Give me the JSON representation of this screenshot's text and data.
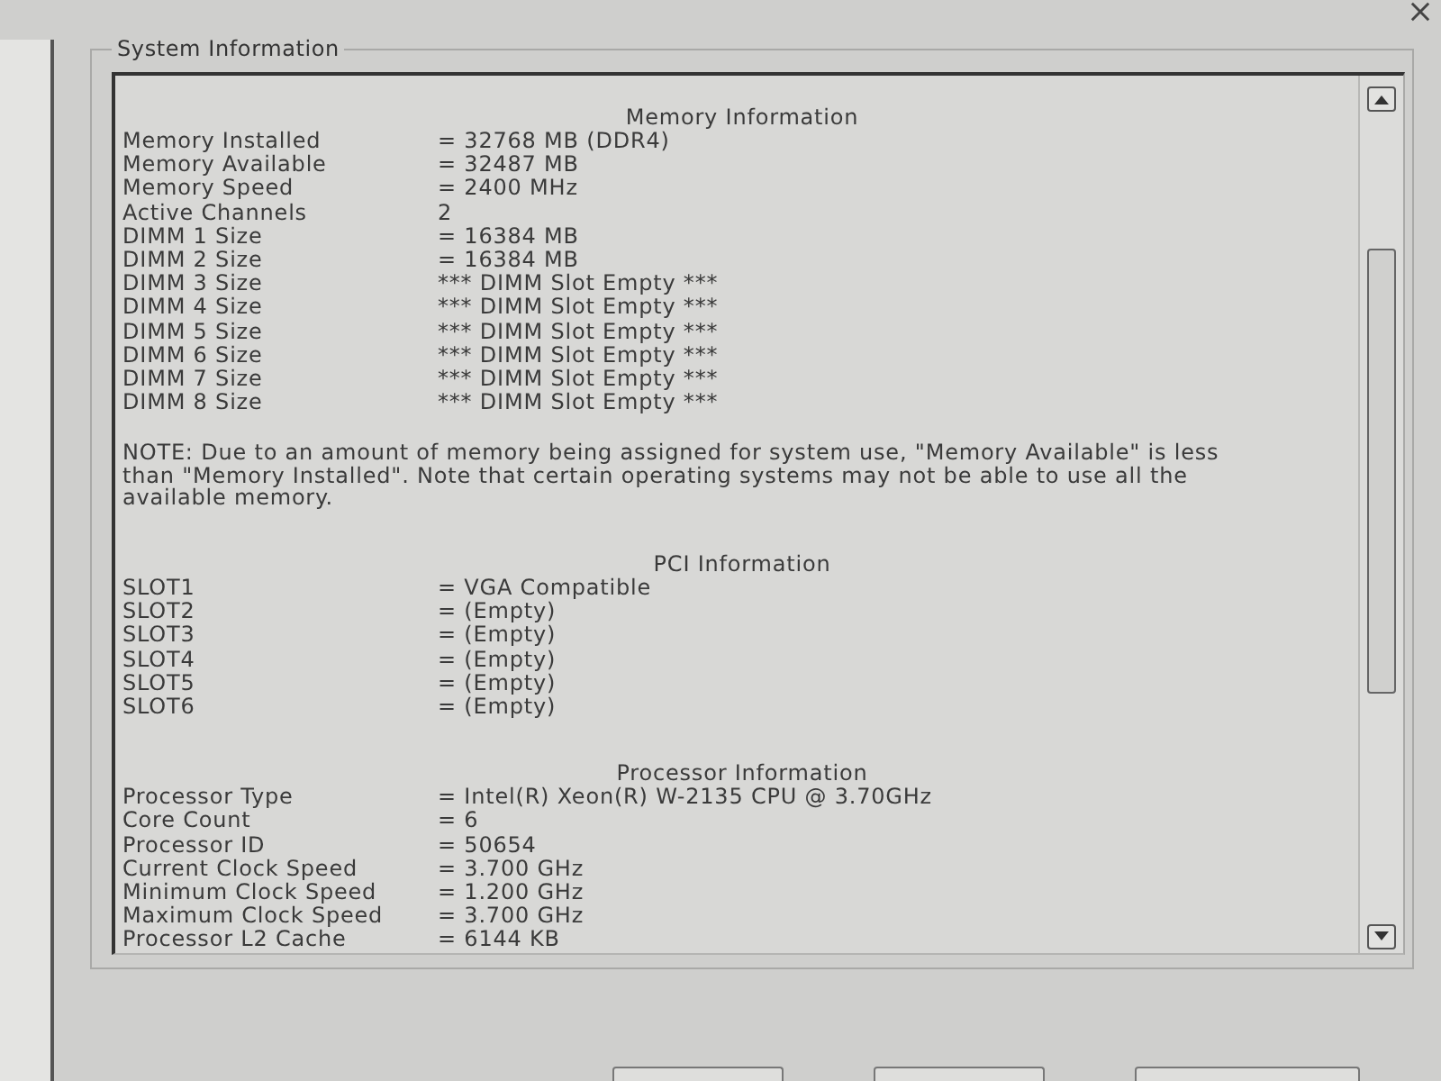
{
  "group_box": {
    "title": "System Information"
  },
  "sections": [
    {
      "heading": "Memory Information",
      "rows": [
        {
          "label": "Memory Installed",
          "value": "= 32768 MB (DDR4)"
        },
        {
          "label": "Memory Available",
          "value": "= 32487 MB"
        },
        {
          "label": "Memory Speed",
          "value": "= 2400 MHz"
        },
        {
          "label": "Active Channels",
          "value": "2"
        },
        {
          "label": "DIMM 1 Size",
          "value": "= 16384 MB"
        },
        {
          "label": "DIMM 2 Size",
          "value": "= 16384 MB"
        },
        {
          "label": "DIMM 3 Size",
          "value": "*** DIMM Slot Empty ***"
        },
        {
          "label": "DIMM 4 Size",
          "value": "*** DIMM Slot Empty ***"
        },
        {
          "label": "DIMM 5 Size",
          "value": "*** DIMM Slot Empty ***"
        },
        {
          "label": "DIMM 6 Size",
          "value": "*** DIMM Slot Empty ***"
        },
        {
          "label": "DIMM 7 Size",
          "value": "*** DIMM Slot Empty ***"
        },
        {
          "label": "DIMM 8 Size",
          "value": "*** DIMM Slot Empty ***"
        }
      ],
      "note": "NOTE: Due to an amount of memory being assigned for system use, \"Memory Available\" is less than \"Memory Installed\". Note that certain operating systems may not be able to use all the available memory."
    },
    {
      "heading": "PCI Information",
      "rows": [
        {
          "label": "SLOT1",
          "value": "= VGA Compatible"
        },
        {
          "label": "SLOT2",
          "value": "= (Empty)"
        },
        {
          "label": "SLOT3",
          "value": "= (Empty)"
        },
        {
          "label": "SLOT4",
          "value": "= (Empty)"
        },
        {
          "label": "SLOT5",
          "value": "= (Empty)"
        },
        {
          "label": "SLOT6",
          "value": "= (Empty)"
        }
      ]
    },
    {
      "heading": "Processor Information",
      "rows": [
        {
          "label": "Processor Type",
          "value": "= Intel(R) Xeon(R) W-2135 CPU @ 3.70GHz"
        },
        {
          "label": "Core Count",
          "value": "= 6"
        },
        {
          "label": "Processor ID",
          "value": "= 50654"
        },
        {
          "label": "Current Clock Speed",
          "value": "= 3.700 GHz"
        },
        {
          "label": "Minimum Clock Speed",
          "value": "= 1.200 GHz"
        },
        {
          "label": "Maximum Clock Speed",
          "value": "= 3.700 GHz"
        },
        {
          "label": "Processor L2 Cache",
          "value": "= 6144 KB"
        }
      ]
    }
  ],
  "footer_buttons": [
    {
      "kind": "button"
    },
    {
      "kind": "button"
    },
    {
      "kind": "button"
    }
  ]
}
